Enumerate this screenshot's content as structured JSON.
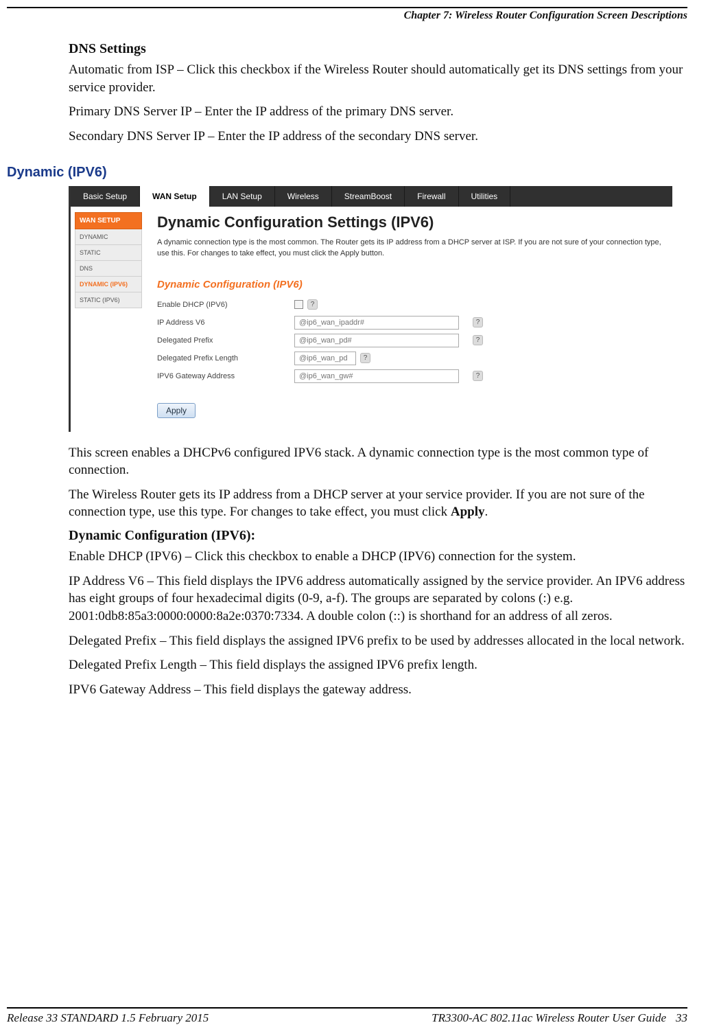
{
  "header": {
    "chapter": "Chapter 7: Wireless Router Configuration Screen Descriptions"
  },
  "dns": {
    "heading": "DNS Settings",
    "auto": "Automatic from ISP – Click this checkbox if the Wireless Router should automatically get its DNS settings from your service provider.",
    "primary": "Primary DNS Server IP – Enter the IP address of the primary DNS server.",
    "secondary": "Secondary DNS Server IP – Enter the IP address of the secondary DNS server."
  },
  "section": {
    "title": "Dynamic (IPV6)"
  },
  "shot": {
    "tabs": {
      "basic": "Basic Setup",
      "wan": "WAN Setup",
      "lan": "LAN Setup",
      "wireless": "Wireless",
      "stream": "StreamBoost",
      "firewall": "Firewall",
      "utilities": "Utilities"
    },
    "side": {
      "head": "WAN SETUP",
      "dynamic": "DYNAMIC",
      "static": "STATIC",
      "dns": "DNS",
      "dynamic6": "DYNAMIC (IPV6)",
      "static6": "STATIC (IPV6)"
    },
    "content": {
      "title": "Dynamic Configuration Settings (IPV6)",
      "desc": "A dynamic connection type is the most common. The Router gets its IP address from a DHCP server at ISP. If you are not sure of your connection type, use this. For changes to take effect, you must click the Apply button.",
      "sub": "Dynamic Configuration (IPV6)",
      "rows": {
        "enable": "Enable DHCP (IPV6)",
        "ip": "IP Address V6",
        "dp": "Delegated Prefix",
        "dpl": "Delegated Prefix Length",
        "gw": "IPV6 Gateway Address"
      },
      "ph": {
        "ip": "@ip6_wan_ipaddr#",
        "dp": "@ip6_wan_pd#",
        "dpl": "@ip6_wan_pd",
        "gw": "@ip6_wan_gw#"
      },
      "help": "?",
      "apply": "Apply"
    }
  },
  "after": {
    "p1": "This screen enables a DHCPv6 configured IPV6 stack. A dynamic connection type is the most common type of connection.",
    "p2a": "The Wireless Router gets its IP address from a DHCP server at your service provider. If you are not sure of the connection type, use this type. For changes to take effect, you must click ",
    "p2b": "Apply",
    "p2c": ".",
    "h": "Dynamic Configuration (IPV6):",
    "enable": "Enable DHCP (IPV6) – Click this checkbox to enable a DHCP (IPV6) connection for the system.",
    "ip": "IP Address V6 – This field displays the IPV6 address automatically assigned by the service provider. An IPV6 address has eight groups of four hexadecimal digits (0-9, a-f). The groups are separated by colons (:) e.g. 2001:0db8:85a3:0000:0000:8a2e:0370:7334. A double colon (::) is shorthand for an address of all zeros.",
    "dp": "Delegated Prefix – This field displays the assigned IPV6 prefix to be used by addresses allocated in the local network.",
    "dpl": "Delegated Prefix Length – This field displays the assigned IPV6 prefix length.",
    "gw": "IPV6 Gateway Address – This field displays the gateway address."
  },
  "footer": {
    "left": "Release 33 STANDARD 1.5    February 2015",
    "right": "TR3300-AC 802.11ac Wireless Router User Guide",
    "page": "33"
  }
}
